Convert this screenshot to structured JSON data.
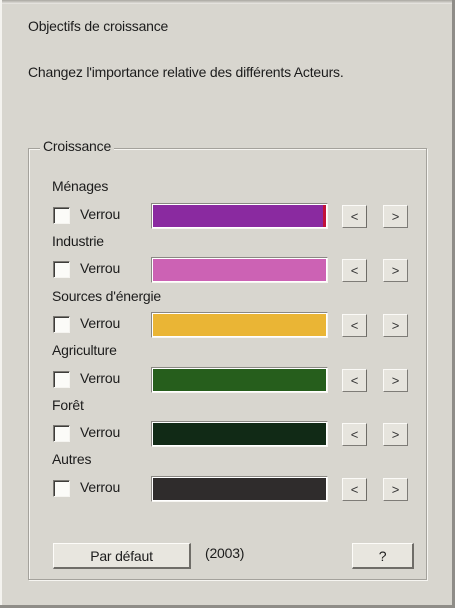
{
  "header": {
    "title": "Objectifs de croissance",
    "description": "Changez l'importance relative des différents Acteurs."
  },
  "group": {
    "legend": "Croissance",
    "lock_label": "Verrou",
    "left_arrow": "<",
    "right_arrow": ">",
    "categories": [
      {
        "label": "Ménages",
        "locked": false,
        "color": "#8a2aa0",
        "level": 1.0,
        "marker": true
      },
      {
        "label": "Industrie",
        "locked": false,
        "color": "#cc62b4",
        "level": 1.0,
        "marker": false
      },
      {
        "label": "Sources d'énergie",
        "locked": false,
        "color": "#eab535",
        "level": 1.0,
        "marker": false
      },
      {
        "label": "Agriculture",
        "locked": false,
        "color": "#265e1c",
        "level": 1.0,
        "marker": false
      },
      {
        "label": "Forêt",
        "locked": false,
        "color": "#112a16",
        "level": 1.0,
        "marker": false
      },
      {
        "label": "Autres",
        "locked": false,
        "color": "#2f2c2c",
        "level": 1.0,
        "marker": false
      }
    ]
  },
  "footer": {
    "default_button": "Par défaut",
    "year": "(2003)",
    "help_button": "?"
  }
}
